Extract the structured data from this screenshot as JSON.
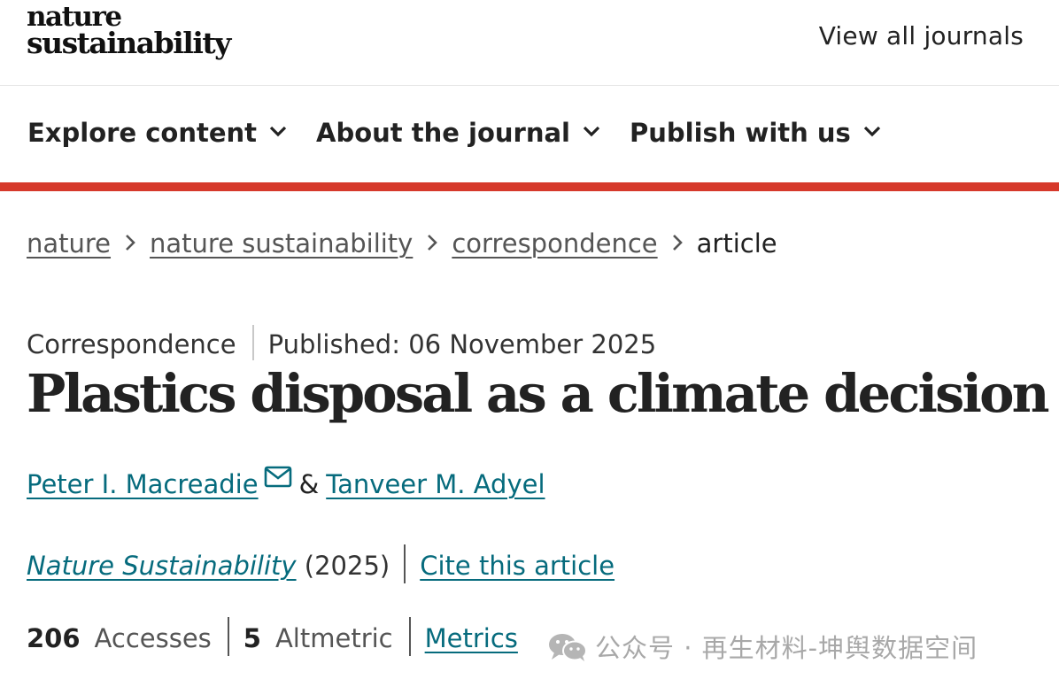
{
  "header": {
    "logo_line1": "nature",
    "logo_line2": "sustainability",
    "view_all": "View all journals"
  },
  "nav": {
    "items": [
      {
        "label": "Explore content"
      },
      {
        "label": "About the journal"
      },
      {
        "label": "Publish with us"
      }
    ],
    "accent_color": "#d6392b"
  },
  "breadcrumb": {
    "items": [
      "nature",
      "nature sustainability",
      "correspondence"
    ],
    "current": "article"
  },
  "article": {
    "type": "Correspondence",
    "published": "Published: 06 November 2025",
    "title": "Plastics disposal as a climate decision",
    "authors": [
      "Peter I. Macreadie",
      "Tanveer M. Adyel"
    ],
    "author_separator": "&",
    "journal": "Nature Sustainability",
    "year": "(2025)",
    "cite": "Cite this article",
    "link_color": "#066b7d"
  },
  "metrics": {
    "accesses_count": "206",
    "accesses_label": "Accesses",
    "altmetric_count": "5",
    "altmetric_label": "Altmetric",
    "metrics_link": "Metrics"
  },
  "watermark": {
    "icon": "wechat-icon",
    "text": "公众号 · 再生材料-坤舆数据空间"
  }
}
